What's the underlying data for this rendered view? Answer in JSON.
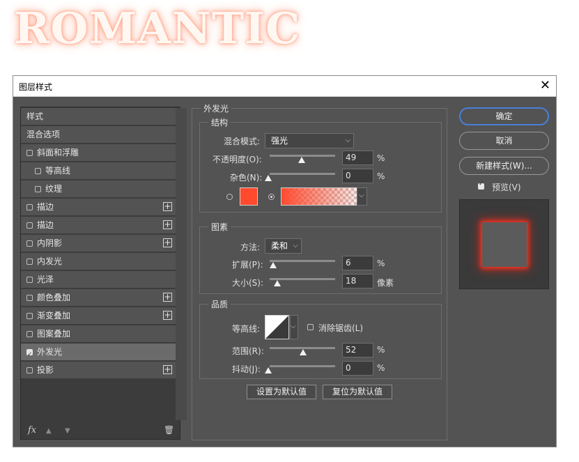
{
  "canvas_text": "ROMANTIC",
  "dialog": {
    "title": "图层样式",
    "close_glyph": "✕"
  },
  "left_items": [
    {
      "label": "样式",
      "checkbox": false,
      "plus": false,
      "indent": 0,
      "selected": false
    },
    {
      "label": "混合选项",
      "checkbox": false,
      "plus": false,
      "indent": 0,
      "selected": false
    },
    {
      "label": "斜面和浮雕",
      "checkbox": true,
      "checked": false,
      "plus": false,
      "indent": 0,
      "selected": false
    },
    {
      "label": "等高线",
      "checkbox": true,
      "checked": false,
      "plus": false,
      "indent": 1,
      "selected": false
    },
    {
      "label": "纹理",
      "checkbox": true,
      "checked": false,
      "plus": false,
      "indent": 1,
      "selected": false
    },
    {
      "label": "描边",
      "checkbox": true,
      "checked": false,
      "plus": true,
      "indent": 0,
      "selected": false
    },
    {
      "label": "描边",
      "checkbox": true,
      "checked": false,
      "plus": true,
      "indent": 0,
      "selected": false
    },
    {
      "label": "内阴影",
      "checkbox": true,
      "checked": false,
      "plus": true,
      "indent": 0,
      "selected": false
    },
    {
      "label": "内发光",
      "checkbox": true,
      "checked": false,
      "plus": false,
      "indent": 0,
      "selected": false
    },
    {
      "label": "光泽",
      "checkbox": true,
      "checked": false,
      "plus": false,
      "indent": 0,
      "selected": false
    },
    {
      "label": "颜色叠加",
      "checkbox": true,
      "checked": false,
      "plus": true,
      "indent": 0,
      "selected": false
    },
    {
      "label": "渐变叠加",
      "checkbox": true,
      "checked": false,
      "plus": true,
      "indent": 0,
      "selected": false
    },
    {
      "label": "图案叠加",
      "checkbox": true,
      "checked": false,
      "plus": false,
      "indent": 0,
      "selected": false
    },
    {
      "label": "外发光",
      "checkbox": true,
      "checked": true,
      "plus": false,
      "indent": 0,
      "selected": true
    },
    {
      "label": "投影",
      "checkbox": true,
      "checked": false,
      "plus": true,
      "indent": 0,
      "selected": false
    }
  ],
  "left_bottom": {
    "fx": "fx",
    "up": "▲",
    "down": "▼",
    "trash": "🗑"
  },
  "main": {
    "title": "外发光",
    "structure": {
      "title": "结构",
      "blend_label": "混合模式:",
      "blend_value": "强光",
      "opacity_label": "不透明度(O):",
      "opacity_value": "49",
      "noise_label": "杂色(N):",
      "noise_value": "0",
      "percent": "%"
    },
    "elements": {
      "title": "图素",
      "method_label": "方法:",
      "method_value": "柔和",
      "spread_label": "扩展(P):",
      "spread_value": "6",
      "size_label": "大小(S):",
      "size_value": "18",
      "size_unit": "像素",
      "percent": "%"
    },
    "quality": {
      "title": "品质",
      "contour_label": "等高线:",
      "antialias_label": "消除锯齿(L)",
      "range_label": "范围(R):",
      "range_value": "52",
      "jitter_label": "抖动(J):",
      "jitter_value": "0",
      "percent": "%"
    },
    "set_default": "设置为默认值",
    "reset_default": "复位为默认值"
  },
  "right": {
    "ok": "确定",
    "cancel": "取消",
    "new_style": "新建样式(W)...",
    "preview_label": "预览(V)"
  },
  "colors": {
    "glow": "#ff4a2e",
    "accent": "#4a7fd8",
    "panel": "#535353"
  },
  "icons": {
    "caret": "⌵"
  }
}
